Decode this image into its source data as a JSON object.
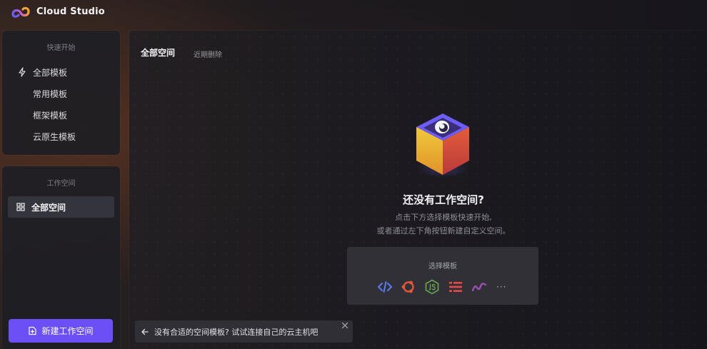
{
  "app": {
    "brand_name": "Cloud Studio"
  },
  "sidebar": {
    "quick_start": {
      "title": "快速开始",
      "items": [
        {
          "label": "全部模板",
          "icon": "lightning-icon"
        },
        {
          "label": "常用模板"
        },
        {
          "label": "框架模板"
        },
        {
          "label": "云原生模板"
        }
      ]
    },
    "workspace": {
      "title": "工作空间",
      "items": [
        {
          "label": "全部空间",
          "icon": "grid-icon",
          "active": true
        }
      ]
    },
    "new_button": {
      "label": "新建工作空间",
      "icon": "new-file-icon"
    }
  },
  "main": {
    "tabs": [
      {
        "label": "全部空间",
        "active": true
      },
      {
        "label": "近期删除"
      }
    ],
    "empty_state": {
      "title": "还没有工作空间?",
      "desc_line1": "点击下方选择模板快速开始,",
      "desc_line2": "或者通过左下角按钮新建自定义空间。"
    },
    "template_picker": {
      "title": "选择模板",
      "icons": [
        "code-icon",
        "ubuntu-icon",
        "nodejs-icon",
        "menu-lines-icon",
        "wave-icon"
      ],
      "more_label": "···"
    }
  },
  "banner": {
    "text": "没有合适的空间模板? 试试连接自己的云主机吧",
    "icon": "arrow-left-icon"
  },
  "colors": {
    "accent": "#6c4ff5",
    "panel": "#1e1e24",
    "code": "#5b7cf6",
    "ubuntu": "#e4553a",
    "nodejs": "#6aa84f",
    "menu": "#e84a4a",
    "wave": "#9c4fb0"
  }
}
